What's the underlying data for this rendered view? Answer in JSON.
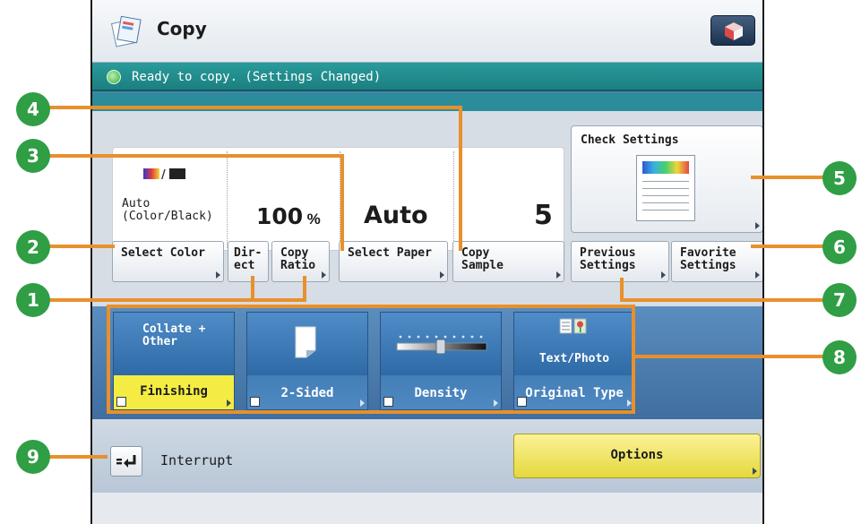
{
  "window": {
    "title": "Copy",
    "home_icon": "cube-icon"
  },
  "status": {
    "text": "Ready to copy. (Settings Changed)",
    "icon": "status-indicator-icon"
  },
  "settings_display": {
    "color_mode": "Auto\n(Color/Black)",
    "ratio_value": "100",
    "ratio_unit": "%",
    "paper": "Auto",
    "copies": "5"
  },
  "buttons": {
    "select_color": "Select Color",
    "direct": "Dir-\nect",
    "copy_ratio": "Copy\nRatio",
    "select_paper": "Select Paper",
    "copy_sample": "Copy\nSample",
    "check_settings": "Check Settings",
    "previous_settings": "Previous\nSettings",
    "favorite_settings": "Favorite\nSettings"
  },
  "functions": [
    {
      "top_text": "Collate +\nOther",
      "label": "Finishing",
      "highlight": "#f5ec43"
    },
    {
      "top_text": "",
      "label": "2-Sided"
    },
    {
      "top_text": "",
      "label": "Density"
    },
    {
      "top_text": "Text/Photo",
      "label": "Original Type"
    }
  ],
  "bottom": {
    "interrupt_label": "Interrupt",
    "options_label": "Options"
  },
  "callouts": [
    "1",
    "2",
    "3",
    "4",
    "5",
    "6",
    "7",
    "8",
    "9"
  ],
  "colors": {
    "callout_line": "#e8902c",
    "callout_circle": "#2f9e45",
    "status_bar": "#1b7f80"
  }
}
